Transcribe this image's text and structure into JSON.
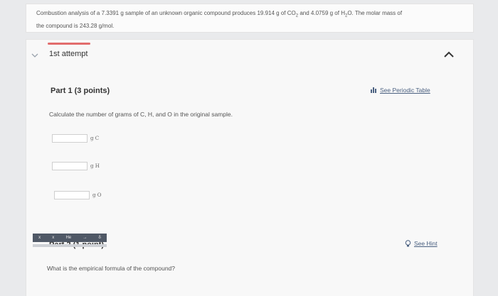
{
  "problem": {
    "line1_a": "Combustion analysis of a",
    "mass": "7.3391",
    "line1_b": "g sample of an unknown organic compound produces",
    "co2_mass": "19.914",
    "g_of": "g of CO",
    "two": "2",
    "and": "and",
    "h2o_mass": "4.0759",
    "g_of_h": "g of H",
    "h_sub": "2",
    "o_tail": "O. The molar mass of",
    "line2": "the compound is 243.28  g/mol."
  },
  "attempt": {
    "label": "1st attempt"
  },
  "part1": {
    "title": "Part 1",
    "points": "(3 points)",
    "periodic_link": "See Periodic Table",
    "instruction": "Calculate the number of grams of C, H, and O in the original sample.",
    "fields": [
      {
        "unit": "g C",
        "value": ""
      },
      {
        "unit": "g H",
        "value": ""
      },
      {
        "unit": "g O",
        "value": ""
      }
    ]
  },
  "part2": {
    "title": "Part 2",
    "points": "(1 point)",
    "hint_link": "See Hint",
    "question": "What is the empirical formula of the compound?",
    "toolbar": [
      "x",
      "x",
      "He",
      "→",
      "δ"
    ]
  },
  "colors": {
    "accent_underline": "#e26d6d",
    "link": "#4a6080",
    "toolbar_bg": "#4f5866"
  }
}
